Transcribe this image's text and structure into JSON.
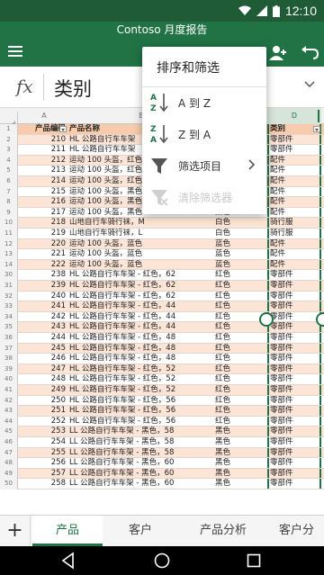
{
  "status_bar": {
    "time": "12:10"
  },
  "window": {
    "title": "Contoso 月度报告"
  },
  "formula_bar": {
    "fx_label": "fx",
    "value": "类别"
  },
  "columns": [
    "A",
    "B",
    "C",
    "D"
  ],
  "header_row": {
    "row_number": "1",
    "code": "产品编码",
    "name": "产品名称",
    "color": "",
    "category": "类别"
  },
  "rows": [
    {
      "n": "2",
      "code": "210",
      "name": "HL 公路自行车车架",
      "color": "",
      "category": "零部件"
    },
    {
      "n": "3",
      "code": "211",
      "name": "HL 公路自行车车架",
      "color": "",
      "category": "零部件"
    },
    {
      "n": "4",
      "code": "212",
      "name": "运动 100 头盔，红色",
      "color": "",
      "category": "配件"
    },
    {
      "n": "5",
      "code": "213",
      "name": "运动 100 头盔，红色",
      "color": "",
      "category": "配件"
    },
    {
      "n": "6",
      "code": "214",
      "name": "运动 100 头盔，红色",
      "color": "",
      "category": "配件"
    },
    {
      "n": "7",
      "code": "215",
      "name": "运动 100 头盔，黑色",
      "color": "",
      "category": "配件"
    },
    {
      "n": "8",
      "code": "216",
      "name": "运动 100 头盔，黑色",
      "color": "",
      "category": "配件"
    },
    {
      "n": "9",
      "code": "217",
      "name": "运动 100 头盔，黑色",
      "color": "黑色",
      "category": "配件"
    },
    {
      "n": "10",
      "code": "218",
      "name": "山地自行车骑行袜，M",
      "color": "白色",
      "category": "骑行服"
    },
    {
      "n": "11",
      "code": "219",
      "name": "山地自行车骑行袜，L",
      "color": "白色",
      "category": "骑行服"
    },
    {
      "n": "12",
      "code": "220",
      "name": "运动 100 头盔，蓝色",
      "color": "蓝色",
      "category": "配件"
    },
    {
      "n": "13",
      "code": "221",
      "name": "运动 100 头盔，蓝色",
      "color": "蓝色",
      "category": "配件"
    },
    {
      "n": "14",
      "code": "222",
      "name": "运动 100 头盔，蓝色",
      "color": "蓝色",
      "category": "配件"
    },
    {
      "n": "30",
      "code": "238",
      "name": "HL 公路自行车车架 - 红色，62",
      "color": "红色",
      "category": "零部件"
    },
    {
      "n": "31",
      "code": "239",
      "name": "HL 公路自行车车架 - 红色，62",
      "color": "红色",
      "category": "零部件"
    },
    {
      "n": "32",
      "code": "240",
      "name": "HL 公路自行车车架 - 红色，62",
      "color": "红色",
      "category": "零部件"
    },
    {
      "n": "33",
      "code": "241",
      "name": "HL 公路自行车车架 - 红色，44",
      "color": "红色",
      "category": "零部件"
    },
    {
      "n": "34",
      "code": "242",
      "name": "HL 公路自行车车架 - 红色，44",
      "color": "红色",
      "category": "零部件"
    },
    {
      "n": "35",
      "code": "243",
      "name": "HL 公路自行车车架 - 红色，44",
      "color": "红色",
      "category": "零部件"
    },
    {
      "n": "36",
      "code": "244",
      "name": "HL 公路自行车车架 - 红色，48",
      "color": "红色",
      "category": "零部件"
    },
    {
      "n": "37",
      "code": "245",
      "name": "HL 公路自行车车架 - 红色，48",
      "color": "红色",
      "category": "零部件"
    },
    {
      "n": "38",
      "code": "246",
      "name": "HL 公路自行车车架 - 红色，48",
      "color": "红色",
      "category": "零部件"
    },
    {
      "n": "39",
      "code": "247",
      "name": "HL 公路自行车车架 - 红色，52",
      "color": "红色",
      "category": "零部件"
    },
    {
      "n": "40",
      "code": "248",
      "name": "HL 公路自行车车架 - 红色，52",
      "color": "红色",
      "category": "零部件"
    },
    {
      "n": "41",
      "code": "249",
      "name": "HL 公路自行车车架 - 红色，52",
      "color": "红色",
      "category": "零部件"
    },
    {
      "n": "42",
      "code": "250",
      "name": "HL 公路自行车车架 - 红色，56",
      "color": "红色",
      "category": "零部件"
    },
    {
      "n": "43",
      "code": "251",
      "name": "HL 公路自行车车架 - 红色，56",
      "color": "红色",
      "category": "零部件"
    },
    {
      "n": "44",
      "code": "252",
      "name": "HL 公路自行车车架 - 红色，56",
      "color": "红色",
      "category": "零部件"
    },
    {
      "n": "45",
      "code": "253",
      "name": "LL 公路自行车车架 - 黑色，58",
      "color": "黑色",
      "category": "零部件"
    },
    {
      "n": "46",
      "code": "254",
      "name": "LL 公路自行车车架 - 黑色，58",
      "color": "黑色",
      "category": "零部件"
    },
    {
      "n": "47",
      "code": "255",
      "name": "LL 公路自行车车架 - 黑色，58",
      "color": "黑色",
      "category": "零部件"
    },
    {
      "n": "48",
      "code": "256",
      "name": "LL 公路自行车车架 - 黑色，60",
      "color": "黑色",
      "category": "零部件"
    },
    {
      "n": "49",
      "code": "257",
      "name": "LL 公路自行车车架 - 黑色，60",
      "color": "黑色",
      "category": "零部件"
    },
    {
      "n": "50",
      "code": "258",
      "name": "LL 公路自行车车架 - 黑色，60",
      "color": "黑色",
      "category": "零部件"
    }
  ],
  "sort_filter_menu": {
    "title": "排序和筛选",
    "items": [
      {
        "label": "A 到 Z",
        "icon": "sort-ascending-icon",
        "enabled": true
      },
      {
        "label": "Z 到 A",
        "icon": "sort-descending-icon",
        "enabled": true
      },
      {
        "label": "筛选项目",
        "icon": "filter-icon",
        "enabled": true
      },
      {
        "label": "清除筛选器",
        "icon": "clear-filter-icon",
        "enabled": false
      }
    ]
  },
  "sheet_tabs": {
    "add_label": "+",
    "tabs": [
      {
        "label": "产品",
        "active": true
      },
      {
        "label": "客户",
        "active": false
      },
      {
        "label": "产品分析",
        "active": false
      },
      {
        "label": "客户分",
        "active": false
      }
    ]
  },
  "colors": {
    "accent": "#217346",
    "status_bar": "#1e5b36",
    "band_row": "#fce4d6",
    "header_row": "#f8cbad"
  }
}
